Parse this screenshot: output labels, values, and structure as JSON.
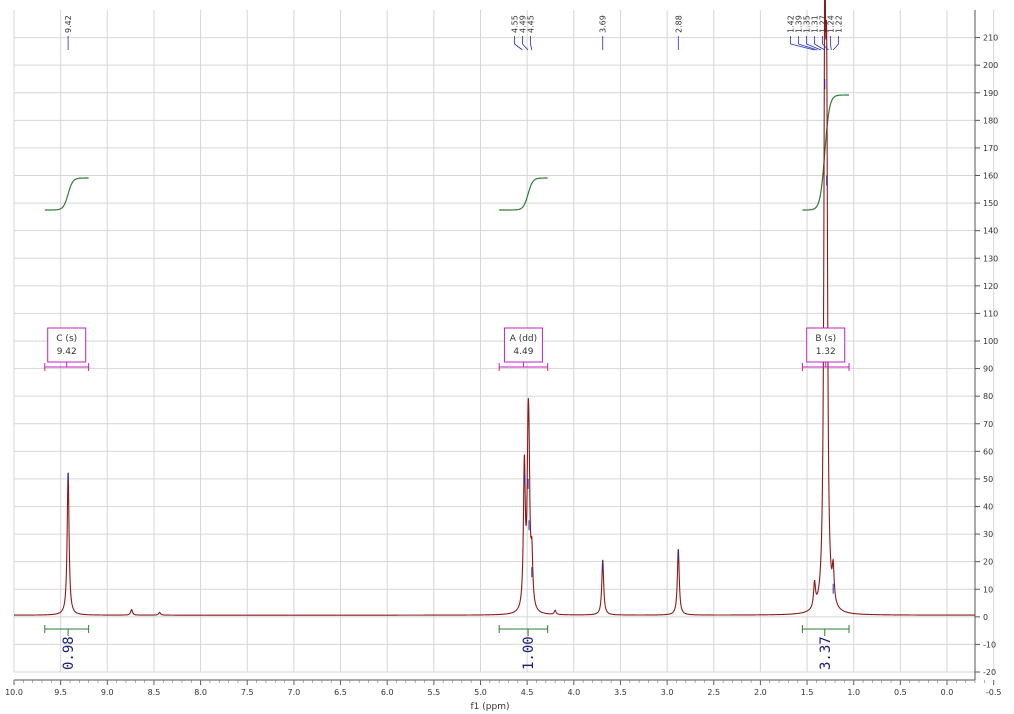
{
  "chart_data": {
    "type": "line",
    "xlabel": "f1 (ppm)",
    "x_axis_reversed": true,
    "xlim": [
      10.0,
      -0.3
    ],
    "ylim": [
      -20,
      220
    ],
    "grid": true,
    "x_ticks": [
      10.0,
      9.5,
      9.0,
      8.5,
      8.0,
      7.5,
      7.0,
      6.5,
      6.0,
      5.5,
      5.0,
      4.5,
      4.0,
      3.5,
      3.0,
      2.5,
      2.0,
      1.5,
      1.0,
      0.5,
      0.0,
      -0.5
    ],
    "x_tick_labels": [
      "10.0",
      "9.5",
      "9.0",
      "8.5",
      "8.0",
      "7.5",
      "7.0",
      "6.5",
      "6.0",
      "5.5",
      "5.0",
      "4.5",
      "4.0",
      "3.5",
      "3.0",
      "2.5",
      "2.0",
      "1.5",
      "1.0",
      "0.5",
      "0.0",
      "-0.5"
    ],
    "y_ticks": [
      -20,
      -10,
      0,
      10,
      20,
      30,
      40,
      50,
      60,
      70,
      80,
      90,
      100,
      110,
      120,
      130,
      140,
      150,
      160,
      170,
      180,
      190,
      200,
      210
    ],
    "colors": {
      "spectrum": "#8b1a1a",
      "integral": "#2e7d32",
      "multiplet": "#c020c0",
      "int_label": "#1a1a7a",
      "grid": "#d6d6d6"
    },
    "peaks": [
      {
        "ppm": 9.42,
        "height": 52
      },
      {
        "ppm": 8.74,
        "height": 2
      },
      {
        "ppm": 8.44,
        "height": 1
      },
      {
        "ppm": 4.53,
        "height": 52
      },
      {
        "ppm": 4.49,
        "height": 50
      },
      {
        "ppm": 4.48,
        "height": 35
      },
      {
        "ppm": 4.45,
        "height": 18
      },
      {
        "ppm": 4.2,
        "height": 1.5
      },
      {
        "ppm": 3.69,
        "height": 20
      },
      {
        "ppm": 2.88,
        "height": 24
      },
      {
        "ppm": 1.42,
        "height": 9
      },
      {
        "ppm": 1.31,
        "height": 195
      },
      {
        "ppm": 1.29,
        "height": 160
      },
      {
        "ppm": 1.22,
        "height": 12
      }
    ],
    "peak_labels": [
      {
        "ppm": 9.42,
        "text": "9.42"
      },
      {
        "ppm": 4.55,
        "text": "4.55"
      },
      {
        "ppm": 4.49,
        "text": "4.49"
      },
      {
        "ppm": 4.45,
        "text": "4.45"
      },
      {
        "ppm": 3.69,
        "text": "3.69"
      },
      {
        "ppm": 2.88,
        "text": "2.88"
      },
      {
        "ppm": 1.42,
        "text": "1.42"
      },
      {
        "ppm": 1.39,
        "text": "1.39"
      },
      {
        "ppm": 1.35,
        "text": "1.35"
      },
      {
        "ppm": 1.31,
        "text": "1.31"
      },
      {
        "ppm": 1.27,
        "text": "1.27"
      },
      {
        "ppm": 1.24,
        "text": "1.24"
      },
      {
        "ppm": 1.22,
        "text": "1.22"
      }
    ],
    "multiplets": [
      {
        "letter_line": "C (s)",
        "shift_line": "9.42",
        "from": 9.67,
        "to": 9.2
      },
      {
        "letter_line": "A (dd)",
        "shift_line": "4.49",
        "from": 4.8,
        "to": 4.28
      },
      {
        "letter_line": "B (s)",
        "shift_line": "1.32",
        "from": 1.55,
        "to": 1.05
      }
    ],
    "integrals": [
      {
        "value": "0.98",
        "from": 9.67,
        "to": 9.2,
        "center": 9.42
      },
      {
        "value": "1.00",
        "from": 4.8,
        "to": 4.28,
        "center": 4.49
      },
      {
        "value": "3.37",
        "from": 1.55,
        "to": 1.05,
        "center": 1.31
      }
    ]
  }
}
